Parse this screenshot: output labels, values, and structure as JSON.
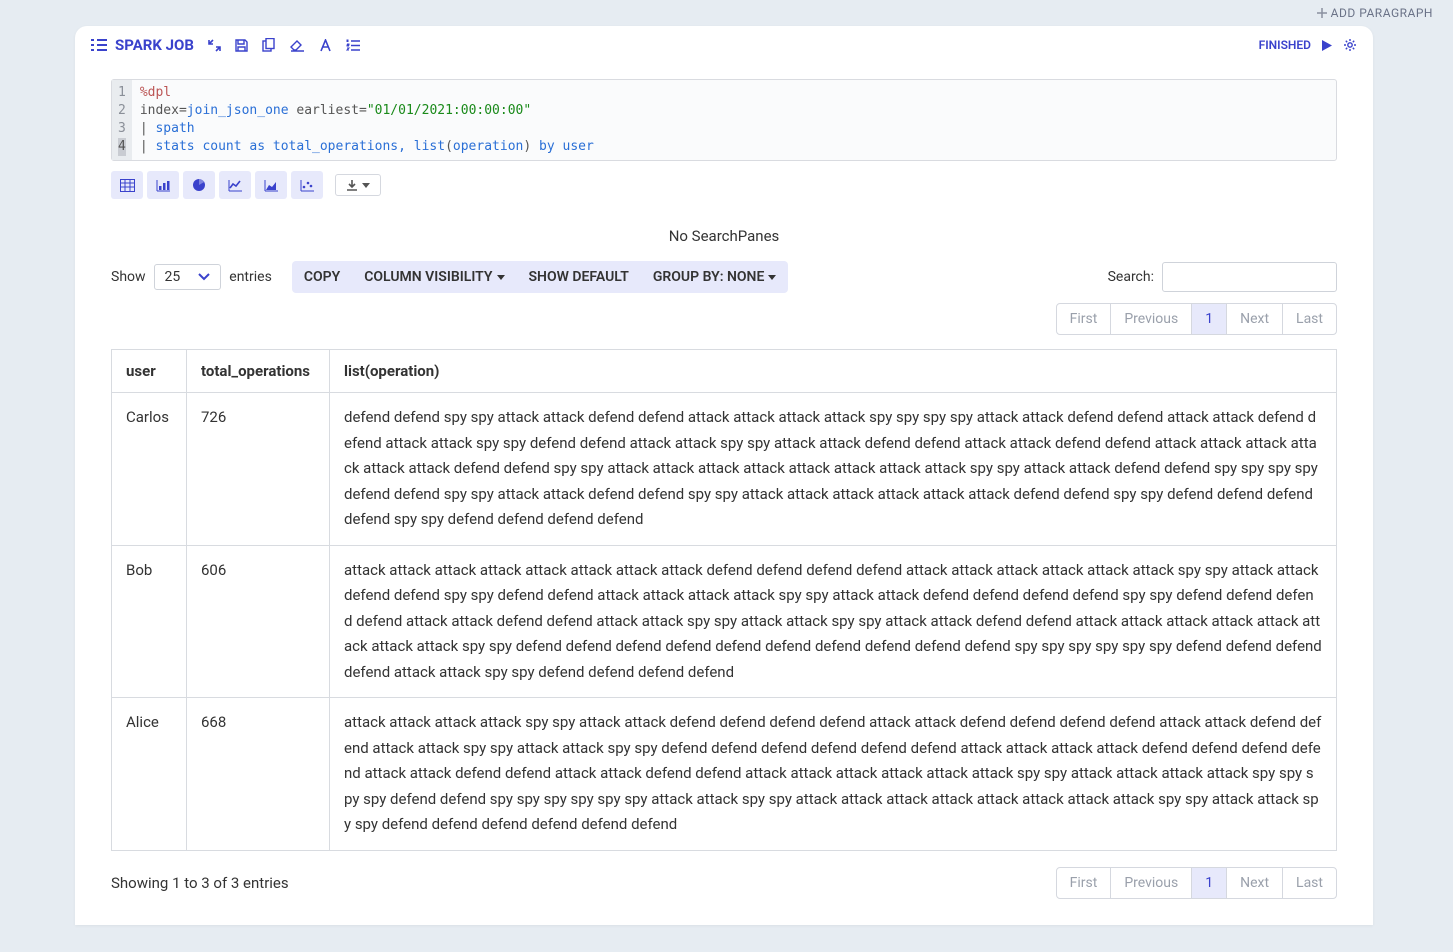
{
  "topbar": {
    "add_paragraph_label": "ADD PARAGRAPH"
  },
  "panel": {
    "title": "SPARK JOB",
    "status": "FINISHED"
  },
  "code": {
    "lines": [
      "1",
      "2",
      "3",
      "4"
    ],
    "l1_cmd": "%dpl",
    "l2_index": "index",
    "l2_eq": "=",
    "l2_val": "join_json_one",
    "l2_earliest": " earliest",
    "l2_eq2": "=",
    "l2_str": "\"01/01/2021:00:00:00\"",
    "l3_pipe": "| ",
    "l3_spath": "spath",
    "l4_pipe": "| ",
    "l4_a": "stats count as total_operations, list",
    "l4_p1": "(",
    "l4_op": "operation",
    "l4_p2": ")",
    "l4_b": " by user"
  },
  "nosearch": "No SearchPanes",
  "show": {
    "label": "Show",
    "value": "25",
    "entries": "entries"
  },
  "buttons": {
    "copy": "COPY",
    "colvis": "COLUMN VISIBILITY",
    "showdefault": "SHOW DEFAULT",
    "groupby": "GROUP BY: NONE"
  },
  "search": {
    "label": "Search:"
  },
  "pagination": {
    "first": "First",
    "previous": "Previous",
    "page": "1",
    "next": "Next",
    "last": "Last"
  },
  "table": {
    "headers": {
      "user": "user",
      "total": "total_operations",
      "list": "list(operation)"
    },
    "rows": [
      {
        "user": "Carlos",
        "total": "726",
        "list": "defend defend spy spy attack attack defend defend attack attack attack attack spy spy spy spy attack attack defend defend attack attack defend defend attack attack spy spy defend defend attack attack spy spy attack attack defend defend attack attack defend defend attack attack attack attack attack attack defend defend spy spy attack attack attack attack attack attack attack attack spy spy attack attack defend defend spy spy spy spy defend defend spy spy attack attack defend defend spy spy attack attack attack attack attack attack defend defend spy spy defend defend defend defend spy spy defend defend defend defend"
      },
      {
        "user": "Bob",
        "total": "606",
        "list": "attack attack attack attack attack attack attack attack defend defend defend defend attack attack attack attack attack attack spy spy attack attack defend defend spy spy defend defend attack attack attack attack spy spy attack attack defend defend defend defend spy spy defend defend defend defend attack attack defend defend attack attack spy spy attack attack spy spy attack attack defend defend attack attack attack attack attack attack attack attack spy spy defend defend defend defend defend defend defend defend defend defend spy spy spy spy spy spy defend defend defend defend attack attack spy spy defend defend defend defend"
      },
      {
        "user": "Alice",
        "total": "668",
        "list": "attack attack attack attack spy spy attack attack defend defend defend defend attack attack defend defend defend defend attack attack defend defend attack attack spy spy attack attack spy spy defend defend defend defend defend defend attack attack attack attack defend defend defend defend attack attack defend defend attack attack defend defend attack attack attack attack attack attack spy spy attack attack attack attack spy spy spy spy defend defend spy spy spy spy spy spy attack attack spy spy attack attack attack attack attack attack attack attack spy spy attack attack spy spy defend defend defend defend defend defend"
      }
    ]
  },
  "info": "Showing 1 to 3 of 3 entries"
}
